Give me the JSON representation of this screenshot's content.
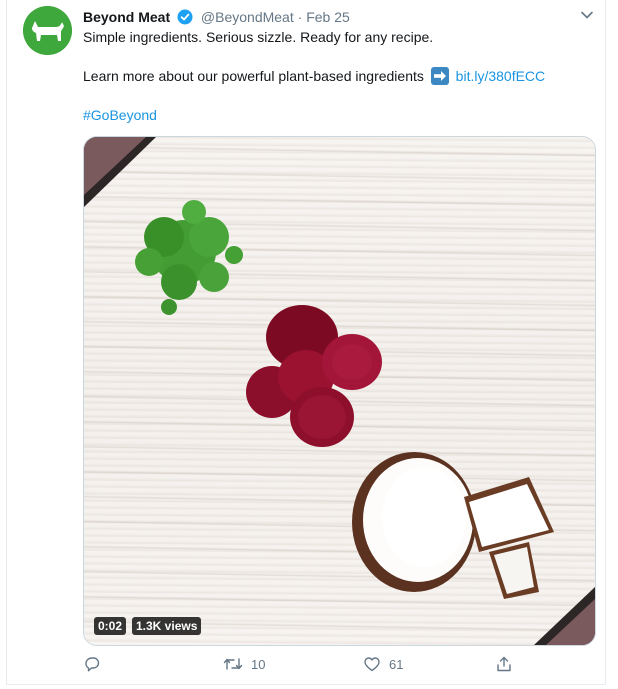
{
  "tweet": {
    "author_name": "Beyond Meat",
    "handle": "@BeyondMeat",
    "separator": "·",
    "date": "Feb 25",
    "line1": "Simple ingredients. Serious sizzle. Ready for any recipe.",
    "line2_text": "Learn more about our powerful plant-based ingredients",
    "line2_link": "bit.ly/380fECC",
    "hashtag": "#GoBeyond"
  },
  "video": {
    "duration": "0:02",
    "views": "1.3K views"
  },
  "actions": {
    "reply_count": "",
    "retweet_count": "10",
    "like_count": "61"
  },
  "colors": {
    "link": "#1b95e0",
    "avatar_bg": "#3ea83c",
    "muted": "#657786",
    "verified": "#1da1f2"
  },
  "icons": [
    "beyond-meat-logo-icon",
    "verified-badge-icon",
    "chevron-down-icon",
    "arrow-right-emoji-icon",
    "reply-icon",
    "retweet-icon",
    "like-icon",
    "share-icon"
  ]
}
